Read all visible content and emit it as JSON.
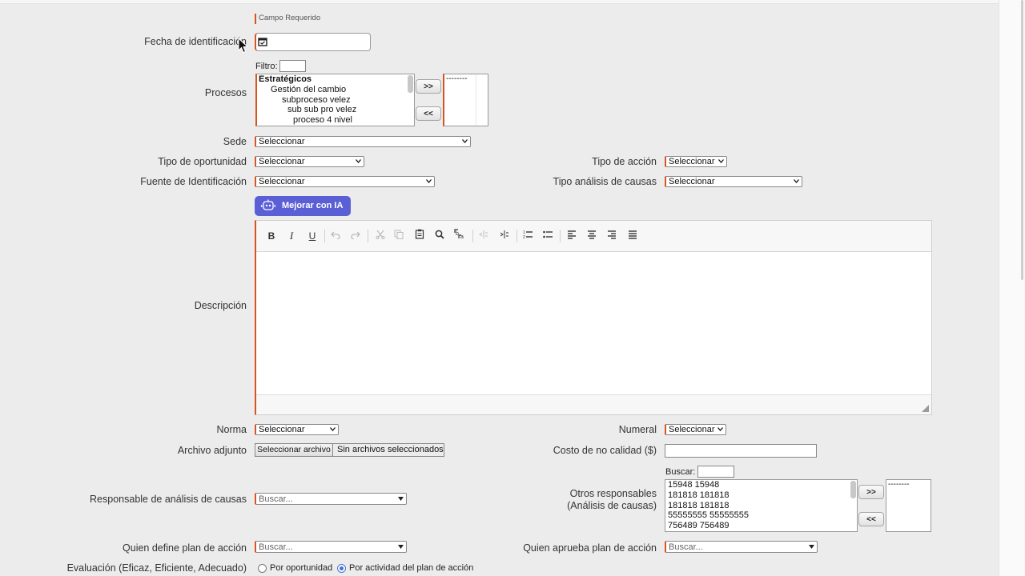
{
  "required_legend": "Campo Requerido",
  "fields": {
    "fecha": {
      "label": "Fecha de identificación"
    },
    "procesos": {
      "label": "Procesos",
      "filter_label": "Filtro:",
      "items": [
        "Estratégicos",
        "Gestión del cambio",
        "subproceso velez",
        "sub sub pro velez",
        "proceso 4 nivel"
      ],
      "selected_items": [
        "--------"
      ],
      "add_label": ">>",
      "remove_label": "<<"
    },
    "sede": {
      "label": "Sede",
      "value": "Seleccionar"
    },
    "tipo_oportunidad": {
      "label": "Tipo de oportunidad",
      "value": "Seleccionar"
    },
    "tipo_accion": {
      "label": "Tipo de acción",
      "value": "Seleccionar"
    },
    "fuente": {
      "label": "Fuente de Identificación",
      "value": "Seleccionar"
    },
    "tipo_analisis": {
      "label": "Tipo análisis de causas",
      "value": "Seleccionar"
    },
    "ai_button": {
      "label": "Mejorar con IA"
    },
    "descripcion": {
      "label": "Descripción"
    },
    "norma": {
      "label": "Norma",
      "value": "Seleccionar"
    },
    "numeral": {
      "label": "Numeral",
      "value": "Seleccionar"
    },
    "archivo": {
      "label": "Archivo adjunto",
      "button": "Seleccionar archivo",
      "status": "Sin archivos seleccionados"
    },
    "costo": {
      "label": "Costo de no calidad ($)"
    },
    "responsable_analisis": {
      "label": "Responsable de análisis de causas",
      "placeholder": "Buscar..."
    },
    "otros_responsables": {
      "label_line1": "Otros responsables",
      "label_line2": "(Análisis de causas)",
      "search_label": "Buscar:",
      "items": [
        "15948 15948",
        "181818 181818",
        "181818 181818",
        "55555555 55555555",
        "756489 756489"
      ],
      "selected_items": [
        "--------"
      ],
      "add_label": ">>",
      "remove_label": "<<"
    },
    "quien_define": {
      "label": "Quien define plan de acción",
      "placeholder": "Buscar..."
    },
    "quien_aprueba": {
      "label": "Quien aprueba plan de acción",
      "placeholder": "Buscar..."
    },
    "evaluacion": {
      "label": "Evaluación (Eficaz, Eficiente, Adecuado)",
      "options": [
        {
          "label": "Por oportunidad",
          "selected": false
        },
        {
          "label": "Por actividad del plan de acción",
          "selected": true
        }
      ]
    }
  },
  "colors": {
    "required_marker": "#d9531e",
    "ai_button": "#5b5fd6",
    "radio_selected": "#4a6fd6"
  },
  "editor_toolbar": [
    "bold-icon",
    "italic-icon",
    "underline-icon",
    "undo-icon",
    "redo-icon",
    "cut-icon",
    "copy-icon",
    "paste-icon",
    "find-icon",
    "replace-icon",
    "outdent-icon",
    "indent-icon",
    "numbered-list-icon",
    "bulleted-list-icon",
    "align-left-icon",
    "align-center-icon",
    "align-right-icon",
    "justify-icon"
  ]
}
